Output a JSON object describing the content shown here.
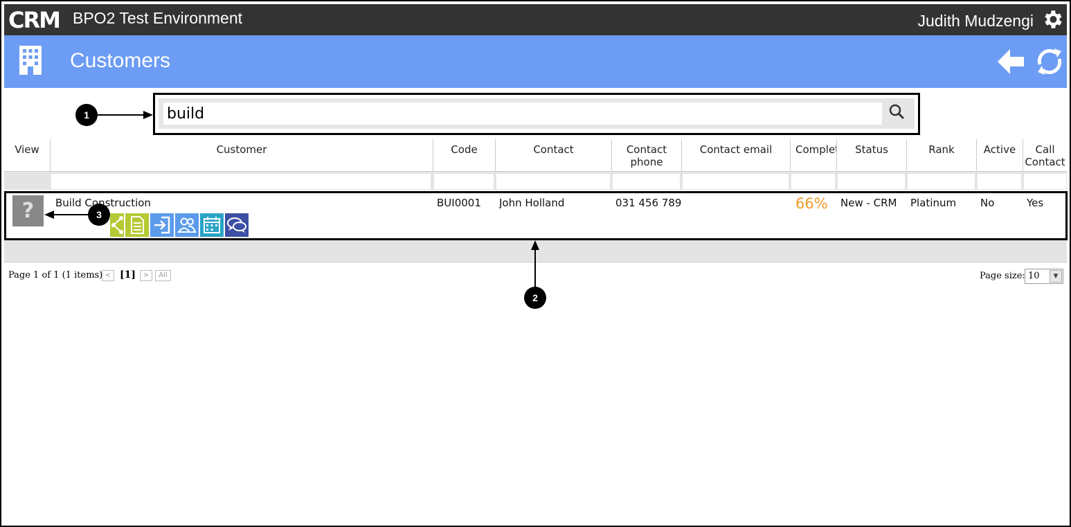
{
  "app": {
    "logo_text": "CRM",
    "environment": "BPO2 Test Environment",
    "user": "Judith Mudzengi"
  },
  "page": {
    "title": "Customers"
  },
  "search": {
    "value": "build"
  },
  "grid": {
    "columns": [
      "View",
      "Customer",
      "Code",
      "Contact",
      "Contact phone",
      "Contact email",
      "Complete",
      "Status",
      "Rank",
      "Active",
      "Call Contact"
    ],
    "column_display": [
      "View",
      "Customer",
      "Code",
      "Contact",
      "Contact\nphone",
      "Contact email",
      "Complete",
      "Status",
      "Rank",
      "Active",
      "Call\nContact"
    ],
    "rows": [
      {
        "customer": "Build Construction",
        "code": "BUI0001",
        "contact": "John Holland",
        "contact_phone": "031 456 789",
        "contact_email": "",
        "complete": "66%",
        "status": "New - CRM",
        "rank": "Platinum",
        "active": "No",
        "call_contact": "Yes"
      }
    ]
  },
  "pager": {
    "summary": "Page 1 of 1 (1 items)",
    "current": "[1]",
    "prev": "<",
    "next": ">",
    "all": "All",
    "page_size_label": "Page size:",
    "page_size": "10"
  },
  "callouts": [
    "1",
    "2",
    "3"
  ],
  "colors": {
    "topbar": "#333333",
    "header": "#6c9cf3",
    "complete": "#f19a2b",
    "icon_lime": "#b5c934",
    "icon_blue": "#5b9bea",
    "icon_teal": "#2aa3c7",
    "icon_navy": "#3d4fa3"
  },
  "action_icons": [
    "share-icon",
    "document-icon",
    "login-icon",
    "contacts-icon",
    "calendar-icon",
    "chat-icon"
  ]
}
